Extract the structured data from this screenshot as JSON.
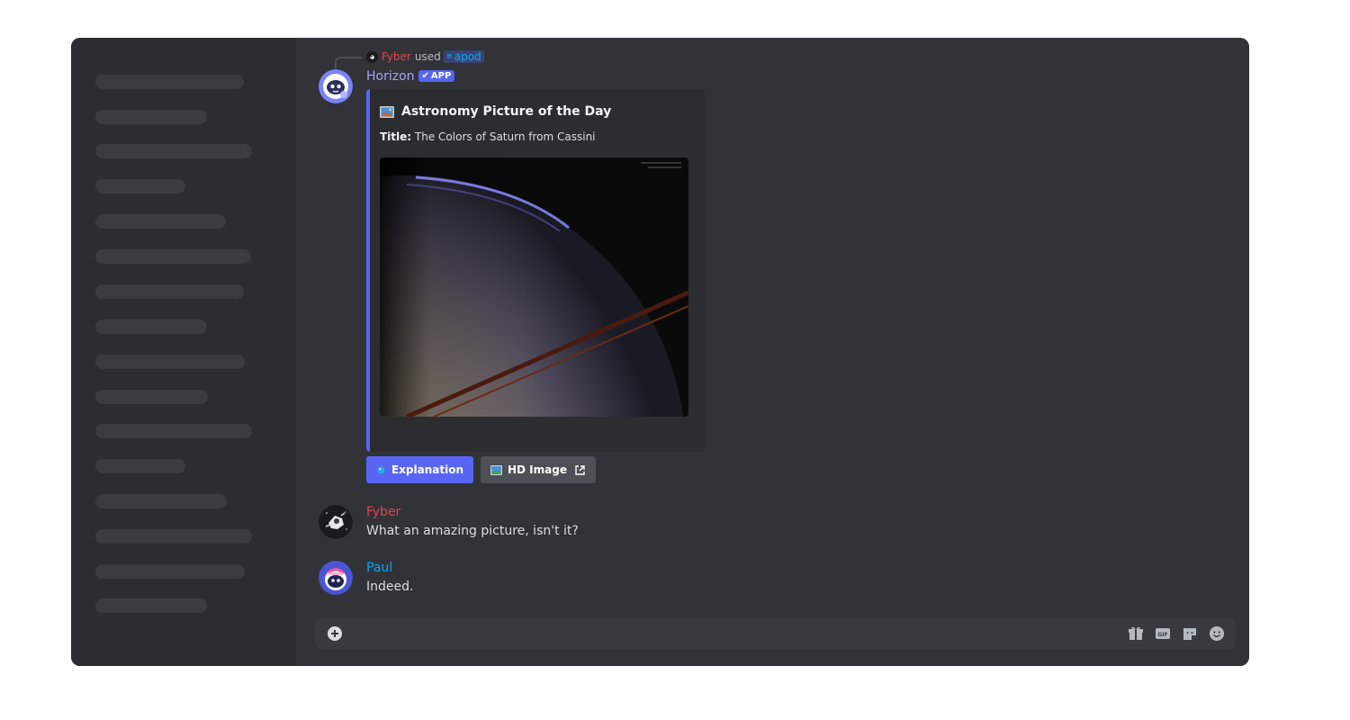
{
  "command_line": {
    "user": "Fyber",
    "used_text": "used",
    "command": "apod"
  },
  "bot_message": {
    "author": "Horizon",
    "badge": "APP",
    "embed": {
      "title": "Astronomy Picture of the Day",
      "field_label": "Title:",
      "field_value": "The Colors of Saturn from Cassini",
      "image_alt": "Saturn photographed by Cassini"
    },
    "buttons": {
      "explanation": "Explanation",
      "hd_image": "HD Image"
    }
  },
  "messages": [
    {
      "author": "Fyber",
      "text": "What an amazing picture, isn't it?",
      "color": "#e0454c"
    },
    {
      "author": "Paul",
      "text": "Indeed.",
      "color": "#00a8fc"
    }
  ],
  "composer": {
    "placeholder": ""
  },
  "colors": {
    "accent": "#5865f2",
    "bot_name": "#a3a6fb",
    "background": "#313338",
    "sidebar": "#2b2d31"
  },
  "icons": {
    "composer_right": [
      "gift-icon",
      "gif-icon",
      "sticker-icon",
      "emoji-icon"
    ]
  }
}
